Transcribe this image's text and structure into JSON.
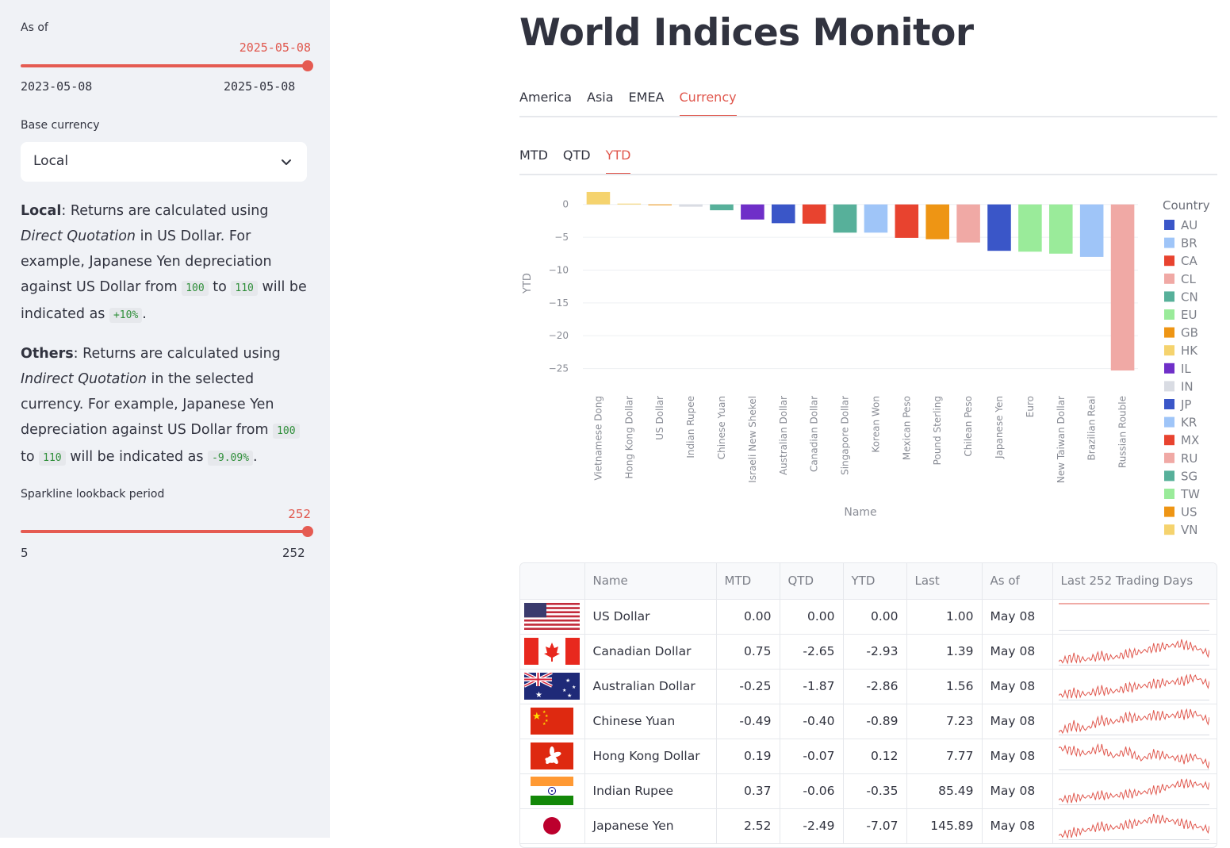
{
  "sidebar": {
    "as_of_label": "As of",
    "as_of_value": "2025-05-08",
    "as_of_min": "2023-05-08",
    "as_of_max": "2025-05-08",
    "as_of_fraction": 1.0,
    "base_currency_label": "Base currency",
    "base_currency_value": "Local",
    "local_desc": {
      "bold": "Local",
      "t1": ": Returns are calculated using ",
      "i1": "Direct Quotation",
      "t2": " in US Dollar. For example, Japanese Yen depreciation against US Dollar from ",
      "c1": "100",
      "t3": " to ",
      "c2": "110",
      "t4": " will be indicated as ",
      "c3": "+10%",
      "t5": "."
    },
    "others_desc": {
      "bold": "Others",
      "t1": ": Returns are calculated using ",
      "i1": "Indirect Quotation",
      "t2": " in the selected currency. For example, Japanese Yen depreciation against US Dollar from ",
      "c1": "100",
      "t3": " to ",
      "c2": "110",
      "t4": " will be indicated as ",
      "c3": "-9.09%",
      "t5": "."
    },
    "sparkline_label": "Sparkline lookback period",
    "sparkline_value": "252",
    "sparkline_min": "5",
    "sparkline_max": "252",
    "sparkline_fraction": 1.0
  },
  "title": "World Indices Monitor",
  "region_tabs": [
    {
      "label": "America",
      "active": false
    },
    {
      "label": "Asia",
      "active": false
    },
    {
      "label": "EMEA",
      "active": false
    },
    {
      "label": "Currency",
      "active": true
    }
  ],
  "period_tabs": [
    {
      "label": "MTD",
      "active": false
    },
    {
      "label": "QTD",
      "active": false
    },
    {
      "label": "YTD",
      "active": true
    }
  ],
  "chart_data": {
    "type": "bar",
    "xlabel": "Name",
    "ylabel": "YTD",
    "yticks": [
      0,
      -5,
      -10,
      -15,
      -20,
      -25
    ],
    "ylim": [
      -26.5,
      2.5
    ],
    "legend_title": "Country",
    "legend_placement": "right",
    "legend": [
      {
        "code": "AU",
        "color": "#3a56c8"
      },
      {
        "code": "BR",
        "color": "#9fc5f8"
      },
      {
        "code": "CA",
        "color": "#e8432f"
      },
      {
        "code": "CL",
        "color": "#f0a9a5"
      },
      {
        "code": "CN",
        "color": "#57b09a"
      },
      {
        "code": "EU",
        "color": "#9aeb9a"
      },
      {
        "code": "GB",
        "color": "#ee9514"
      },
      {
        "code": "HK",
        "color": "#f5d36e"
      },
      {
        "code": "IL",
        "color": "#6f2fc8"
      },
      {
        "code": "IN",
        "color": "#d9dce3"
      },
      {
        "code": "JP",
        "color": "#3a56c8"
      },
      {
        "code": "KR",
        "color": "#9fc5f8"
      },
      {
        "code": "MX",
        "color": "#e8432f"
      },
      {
        "code": "RU",
        "color": "#f0a9a5"
      },
      {
        "code": "SG",
        "color": "#57b09a"
      },
      {
        "code": "TW",
        "color": "#9aeb9a"
      },
      {
        "code": "US",
        "color": "#ee9514"
      },
      {
        "code": "VN",
        "color": "#f5d36e"
      }
    ],
    "bars": [
      {
        "name": "Vietnamese Dong",
        "country": "VN",
        "value": 1.9
      },
      {
        "name": "Hong Kong Dollar",
        "country": "HK",
        "value": 0.12
      },
      {
        "name": "US Dollar",
        "country": "US",
        "value": 0.0
      },
      {
        "name": "Indian Rupee",
        "country": "IN",
        "value": -0.35
      },
      {
        "name": "Chinese Yuan",
        "country": "CN",
        "value": -0.89
      },
      {
        "name": "Israeli New Shekel",
        "country": "IL",
        "value": -2.3
      },
      {
        "name": "Australian Dollar",
        "country": "AU",
        "value": -2.86
      },
      {
        "name": "Canadian Dollar",
        "country": "CA",
        "value": -2.93
      },
      {
        "name": "Singapore Dollar",
        "country": "SG",
        "value": -4.3
      },
      {
        "name": "Korean Won",
        "country": "KR",
        "value": -4.3
      },
      {
        "name": "Mexican Peso",
        "country": "MX",
        "value": -5.1
      },
      {
        "name": "Pound Sterling",
        "country": "GB",
        "value": -5.3
      },
      {
        "name": "Chilean Peso",
        "country": "CL",
        "value": -5.8
      },
      {
        "name": "Japanese Yen",
        "country": "JP",
        "value": -7.07
      },
      {
        "name": "Euro",
        "country": "EU",
        "value": -7.2
      },
      {
        "name": "New Taiwan Dollar",
        "country": "TW",
        "value": -7.5
      },
      {
        "name": "Brazilian Real",
        "country": "BR",
        "value": -8.0
      },
      {
        "name": "Russian Rouble",
        "country": "RU",
        "value": -25.3
      }
    ]
  },
  "table": {
    "headers": [
      "",
      "Name",
      "MTD",
      "QTD",
      "YTD",
      "Last",
      "As of",
      "Last 252 Trading Days"
    ],
    "rows": [
      {
        "flag": "us",
        "name": "US Dollar",
        "mtd": "0.00",
        "qtd": "0.00",
        "ytd": "0.00",
        "last": "1.00",
        "asof": "May 08",
        "spark": [
          0,
          0,
          0,
          0,
          0,
          0,
          0,
          0,
          0,
          0,
          0,
          0
        ]
      },
      {
        "flag": "ca",
        "name": "Canadian Dollar",
        "mtd": "0.75",
        "qtd": "-2.65",
        "ytd": "-2.93",
        "last": "1.39",
        "asof": "May 08",
        "spark": [
          1.35,
          1.37,
          1.36,
          1.38,
          1.37,
          1.39,
          1.4,
          1.42,
          1.43,
          1.44,
          1.42,
          1.39
        ]
      },
      {
        "flag": "au",
        "name": "Australian Dollar",
        "mtd": "-0.25",
        "qtd": "-1.87",
        "ytd": "-2.86",
        "last": "1.56",
        "asof": "May 08",
        "spark": [
          1.48,
          1.5,
          1.49,
          1.52,
          1.51,
          1.54,
          1.55,
          1.57,
          1.58,
          1.59,
          1.62,
          1.56
        ]
      },
      {
        "flag": "cn",
        "name": "Chinese Yuan",
        "mtd": "-0.49",
        "qtd": "-0.40",
        "ytd": "-0.89",
        "last": "7.23",
        "asof": "May 08",
        "spark": [
          7.1,
          7.18,
          7.14,
          7.24,
          7.22,
          7.28,
          7.26,
          7.3,
          7.29,
          7.31,
          7.32,
          7.23
        ]
      },
      {
        "flag": "hk",
        "name": "Hong Kong Dollar",
        "mtd": "0.19",
        "qtd": "-0.07",
        "ytd": "0.12",
        "last": "7.77",
        "asof": "May 08",
        "spark": [
          7.83,
          7.82,
          7.81,
          7.83,
          7.8,
          7.82,
          7.79,
          7.81,
          7.8,
          7.79,
          7.8,
          7.77
        ]
      },
      {
        "flag": "in",
        "name": "Indian Rupee",
        "mtd": "0.37",
        "qtd": "-0.06",
        "ytd": "-0.35",
        "last": "85.49",
        "asof": "May 08",
        "spark": [
          82.0,
          82.5,
          82.8,
          83.2,
          83.0,
          83.5,
          83.8,
          84.5,
          85.3,
          86.2,
          86.0,
          85.49
        ]
      },
      {
        "flag": "jp",
        "name": "Japanese Yen",
        "mtd": "2.52",
        "qtd": "-2.49",
        "ytd": "-7.07",
        "last": "145.89",
        "asof": "May 08",
        "spark": [
          138,
          142,
          145,
          150,
          148,
          152,
          155,
          160,
          158,
          154,
          150,
          145.89
        ]
      }
    ]
  }
}
